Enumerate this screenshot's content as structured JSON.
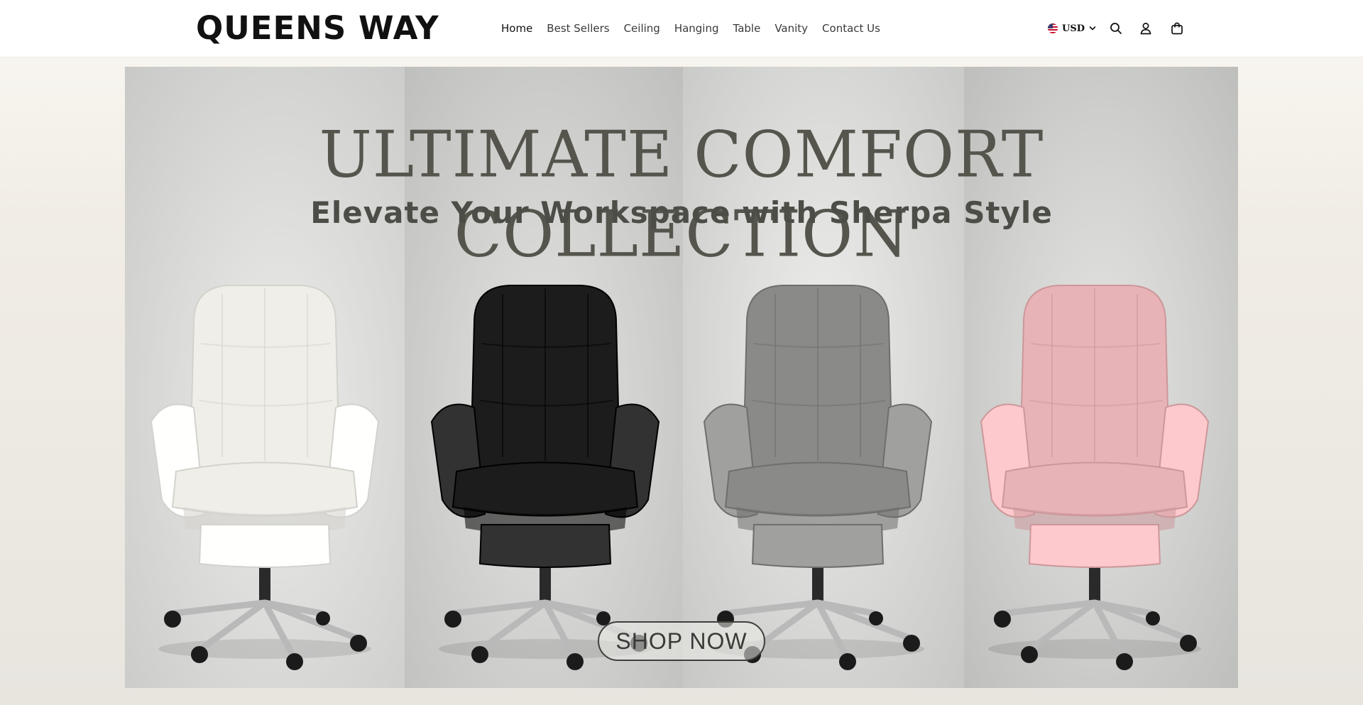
{
  "header": {
    "logo": "QUEENS WAY",
    "nav": [
      {
        "label": "Home",
        "active": true
      },
      {
        "label": "Best Sellers",
        "active": false
      },
      {
        "label": "Ceiling",
        "active": false
      },
      {
        "label": "Hanging",
        "active": false
      },
      {
        "label": "Table",
        "active": false
      },
      {
        "label": "Vanity",
        "active": false
      },
      {
        "label": "Contact Us",
        "active": false
      }
    ],
    "currency": {
      "code": "USD",
      "flag_icon": "us-flag-icon",
      "dropdown_icon": "chevron-down-icon"
    },
    "icons": [
      "search-icon",
      "account-icon",
      "cart-icon"
    ]
  },
  "hero": {
    "title": "ULTIMATE COMFORT COLLECTION",
    "subtitle": "Elevate Your Workspace with Sherpa Style",
    "cta": "SHOP NOW",
    "chairs": [
      {
        "name": "white-chair",
        "color": "#efeee8"
      },
      {
        "name": "black-chair",
        "color": "#1c1c1c"
      },
      {
        "name": "gray-chair",
        "color": "#8a8a88"
      },
      {
        "name": "pink-chair",
        "color": "#e8b3b6"
      }
    ]
  },
  "colors": {
    "title_text": "#55554d",
    "header_bg": "#ffffff",
    "page_bg": "#ece8e2"
  }
}
